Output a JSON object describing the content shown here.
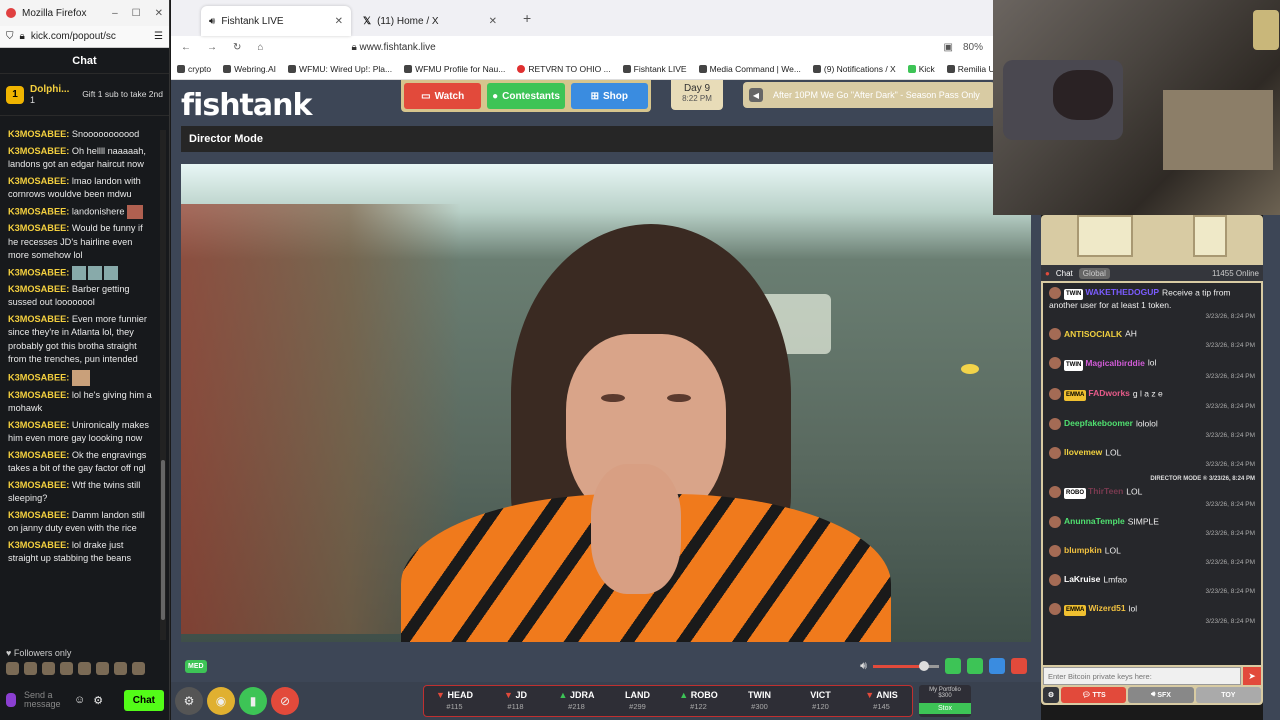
{
  "kick": {
    "window_title": "Mozilla Firefox",
    "url": "kick.com/popout/sc",
    "chat_title": "Chat",
    "pinned": {
      "badge": "1",
      "name": "Dolphi...",
      "count": "1",
      "gift_text": "Gift 1 sub to take 2nd"
    },
    "messages": [
      {
        "user": "K3MOSABEE:",
        "text": "Snooooooooood"
      },
      {
        "user": "K3MOSABEE:",
        "text": "Oh hellll naaaaah, landons got an edgar haircut now"
      },
      {
        "user": "K3MOSABEE:",
        "text": "lmao landon with cornrows wouldve been mdwu"
      },
      {
        "user": "K3MOSABEE:",
        "text": "landonishere"
      },
      {
        "user": "K3MOSABEE:",
        "text": "Would be funny if he recesses JD's hairline even more somehow lol"
      },
      {
        "user": "K3MOSABEE:",
        "text": ""
      },
      {
        "user": "K3MOSABEE:",
        "text": "Barber getting sussed out loooooool"
      },
      {
        "user": "K3MOSABEE:",
        "text": "Even more funnier since they're in Atlanta lol, they probably got this brotha straight from the trenches, pun intended"
      },
      {
        "user": "K3MOSABEE:",
        "text": ""
      },
      {
        "user": "K3MOSABEE:",
        "text": "lol he's giving him a mohawk"
      },
      {
        "user": "K3MOSABEE:",
        "text": "Unironically makes him even more gay loooking now"
      },
      {
        "user": "K3MOSABEE:",
        "text": "Ok the engravings takes a bit of the gay factor off ngl"
      },
      {
        "user": "K3MOSABEE:",
        "text": "Wtf the twins still sleeping?"
      },
      {
        "user": "K3MOSABEE:",
        "text": "Damm landon still on janny duty even with the rice"
      },
      {
        "user": "K3MOSABEE:",
        "text": "lol drake just straight up stabbing the beans"
      }
    ],
    "followers_only": "Followers only",
    "input_placeholder": "Send a message",
    "chat_button": "Chat"
  },
  "browser": {
    "tabs": [
      {
        "label": "Fishtank LIVE",
        "active": true
      },
      {
        "label": "(11) Home / X",
        "active": false
      }
    ],
    "url": "www.fishtank.live",
    "zoom": "80%",
    "bookmarks": [
      "crypto",
      "Webring.AI",
      "WFMU: Wired Up!: Pla...",
      "WFMU Profile for Nau...",
      "RETVRN TO OHIO ...",
      "Fishtank LIVE",
      "Media Command | We...",
      "(9) Notifications / X",
      "Kick",
      "Remilia User Profiles"
    ]
  },
  "fishtank": {
    "logo": "fishtank",
    "nav": {
      "watch": "Watch",
      "contestants": "Contestants",
      "shop": "Shop"
    },
    "day": "Day 9",
    "time": "8:22 PM",
    "ticker": "After 10PM We Go \"After Dark\" - Season Pass Only",
    "mode_title": "Director Mode",
    "quality_badge": "MED",
    "volume": 0.75,
    "cams": [
      {
        "name": "HEAD",
        "num": "#115",
        "dir": "down"
      },
      {
        "name": "JD",
        "num": "#118",
        "dir": "down"
      },
      {
        "name": "JDRA",
        "num": "#218",
        "dir": "up"
      },
      {
        "name": "LAND",
        "num": "#299",
        "dir": ""
      },
      {
        "name": "ROBO",
        "num": "#122",
        "dir": "up"
      },
      {
        "name": "TWIN",
        "num": "#300",
        "dir": ""
      },
      {
        "name": "VICT",
        "num": "#120",
        "dir": ""
      },
      {
        "name": "ANIS",
        "num": "#145",
        "dir": "down"
      }
    ],
    "portfolio": {
      "title": "My Portfolio",
      "value": "$300",
      "stox": "Stox"
    }
  },
  "right_chat": {
    "tab_chat": "Chat",
    "tab_global": "Global",
    "online": "11455 Online",
    "messages": [
      {
        "tag": "TWIN",
        "user": "WAKETHEDOGUP",
        "color": "#7b5cff",
        "text": "Receive a tip from another user for at least 1 token.",
        "time": "3/23/26, 8:24 PM"
      },
      {
        "tag": "",
        "user": "ANTISOCIALK",
        "color": "#f0d040",
        "text": "AH",
        "time": "3/23/26, 8:24 PM"
      },
      {
        "tag": "TWIN",
        "user": "Magicalbirddie",
        "color": "#d05bd6",
        "text": "lol",
        "time": "3/23/26, 8:24 PM"
      },
      {
        "tag": "EMMA",
        "user": "FADworks",
        "color": "#e85b8a",
        "text": "g l a z e",
        "time": "3/23/26, 8:24 PM"
      },
      {
        "tag": "",
        "user": "Deepfakeboomer",
        "color": "#50e070",
        "text": "lololol",
        "time": "3/23/26, 8:24 PM"
      },
      {
        "tag": "",
        "user": "llovemew",
        "color": "#f0d040",
        "text": "LOL",
        "time": "3/23/26, 8:24 PM"
      },
      {
        "tag": "ROBO",
        "user": "ThirTeen",
        "color": "#7a3a50",
        "text": "LOL",
        "time": "3/23/26, 8:24 PM"
      },
      {
        "tag": "",
        "user": "AnunnaTemple",
        "color": "#50e070",
        "text": "SIMPLE",
        "time": "3/23/26, 8:24 PM"
      },
      {
        "tag": "",
        "user": "blumpkin",
        "color": "#f0c040",
        "text": "LOL",
        "time": "3/23/26, 8:24 PM"
      },
      {
        "tag": "",
        "user": "LaKruise",
        "color": "#ffffff",
        "text": "Lmfao",
        "time": "3/23/26, 8:24 PM"
      },
      {
        "tag": "EMMA",
        "user": "Wizerd51",
        "color": "#f0c040",
        "text": "lol",
        "time": "3/23/26, 8:24 PM"
      }
    ],
    "system_note": "DIRECTOR MODE ® 3/23/26, 8:24 PM",
    "input_placeholder": "Enter Bitcoin private keys here:",
    "buttons": {
      "tts": "TTS",
      "sfx": "SFX",
      "toy": "TOY"
    }
  }
}
